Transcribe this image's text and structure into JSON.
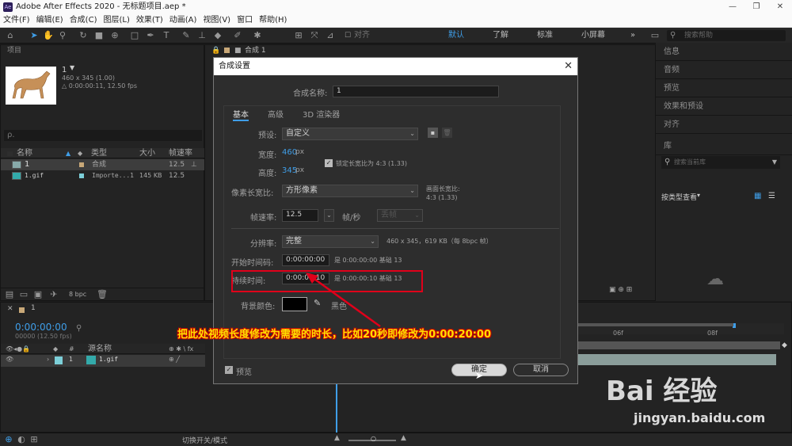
{
  "window": {
    "app_logo": "Ae",
    "title": "Adobe After Effects 2020 - 无标题项目.aep *"
  },
  "menu": [
    "文件(F)",
    "编辑(E)",
    "合成(C)",
    "图层(L)",
    "效果(T)",
    "动画(A)",
    "视图(V)",
    "窗口",
    "帮助(H)"
  ],
  "toolbar": {
    "snap": "对齐",
    "workspaces": [
      "默认",
      "了解",
      "标准",
      "小屏幕"
    ],
    "search_placeholder": "搜索帮助"
  },
  "project": {
    "tab": "项目",
    "name": "1",
    "size": "460 x 345 (1.00)",
    "duration": "△ 0:00:00:11, 12.50 fps",
    "search_placeholder": "ρ.",
    "columns": [
      "名称",
      "类型",
      "大小",
      "帧速率"
    ],
    "items": [
      {
        "name": "1",
        "type": "合成",
        "size": "",
        "fps": "12.5"
      },
      {
        "name": "1.gif",
        "type": "Importe...1",
        "size": "145 KB",
        "fps": "12.5"
      }
    ],
    "bpc": "8 bpc"
  },
  "comp_tab": "合成 1",
  "right_panel": {
    "items": [
      "信息",
      "音频",
      "预览",
      "效果和预设",
      "对齐"
    ],
    "library": "库",
    "lib_search": "搜索当前库",
    "browse": "按类型查看"
  },
  "timeline": {
    "tab": "1",
    "timecode": "0:00:00:00",
    "fps": "00000 (12.50 fps)",
    "col_source": "源名称",
    "layer_num": "1",
    "layer_name": "1.gif",
    "toggle": "切换开关/模式",
    "ruler": [
      "06f",
      "08f"
    ]
  },
  "dialog": {
    "title": "合成设置",
    "name_label": "合成名称:",
    "name_value": "1",
    "tabs": [
      "基本",
      "高级",
      "3D 渲染器"
    ],
    "preset_label": "预设:",
    "preset_value": "自定义",
    "width_label": "宽度:",
    "width_value": "460",
    "px": "px",
    "height_label": "高度:",
    "height_value": "345",
    "lock_aspect": "锁定长宽比为 4:3 (1.33)",
    "par_label": "像素长宽比:",
    "par_value": "方形像素",
    "frame_aspect_label": "画面长宽比:",
    "frame_aspect_value": "4:3 (1.33)",
    "fps_label": "帧速率:",
    "fps_value": "12.5",
    "fps_unit": "帧/秒",
    "fps_drop": "丢帧",
    "res_label": "分辨率:",
    "res_value": "完整",
    "res_info": "460 x 345，619 KB（每 8bpc 帧）",
    "start_label": "开始时间码:",
    "start_value": "0:00:00:00",
    "start_info": "是 0:00:00:00  基础 13",
    "dur_label": "持续时间:",
    "dur_value": "0:00:00:10",
    "dur_info": "是 0:00:00:10  基础 13",
    "bg_label": "背景颜色:",
    "bg_name": "黑色",
    "preview": "预览",
    "ok": "确定",
    "cancel": "取消"
  },
  "annotation": "把此处视频长度修改为需要的时长，比如20秒即修改为0:00:20:00",
  "watermark": {
    "logo": "Bai 经验",
    "url": "jingyan.baidu.com"
  },
  "colors": {
    "accent": "#3f9ee8",
    "highlight": "#e0001a",
    "annotation_text": "#ffe000",
    "bg": "#1d1d1d",
    "dialog": "#2d2d2d"
  }
}
